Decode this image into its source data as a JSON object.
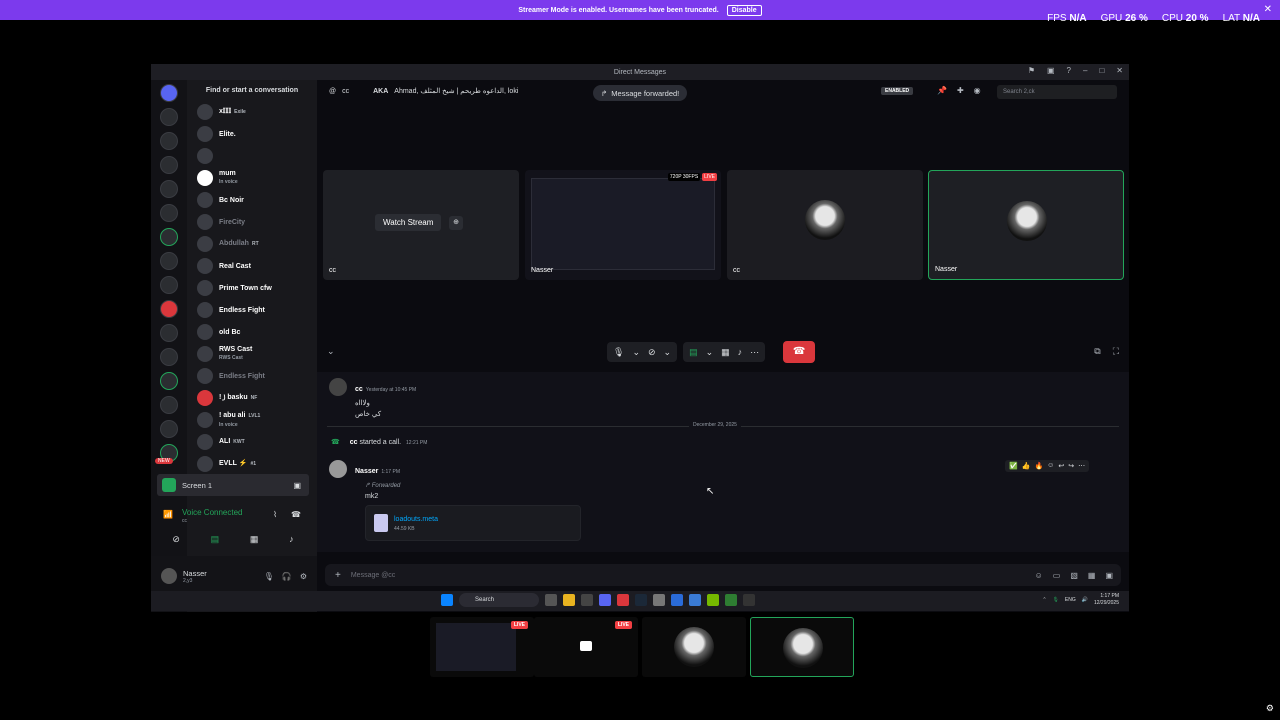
{
  "streamer": {
    "message": "Streamer Mode is enabled. Usernames have been truncated.",
    "button": "Disable"
  },
  "stats": {
    "fps_label": "FPS",
    "fps": "N/A",
    "gpu_label": "GPU",
    "gpu": "26 %",
    "cpu_label": "CPU",
    "cpu": "20 %",
    "lat_label": "LAT",
    "lat": "N/A"
  },
  "window": {
    "title": "Direct Messages"
  },
  "dmlist": {
    "search": "Find or start a conversation",
    "items": [
      {
        "name": "x𝕀𝕀𝕀",
        "tag": "Exile"
      },
      {
        "name": "Elite.",
        "tag": ""
      },
      {
        "name": "",
        "tag": ""
      },
      {
        "name": "mum",
        "tag": "",
        "sub": "In voice"
      },
      {
        "name": "Bc Noir",
        "tag": ""
      },
      {
        "name": "FireCity",
        "tag": ""
      },
      {
        "name": "Abdullah",
        "tag": "RT"
      },
      {
        "name": "Real Cast",
        "tag": ""
      },
      {
        "name": "Prime Town cfw",
        "tag": ""
      },
      {
        "name": "Endless Fight",
        "tag": ""
      },
      {
        "name": "old Bc",
        "tag": ""
      },
      {
        "name": "RWS Cast",
        "tag": "",
        "sub": "RWS Cast"
      },
      {
        "name": "Endless Fight",
        "tag": ""
      },
      {
        "name": "! ꠸ basku",
        "tag": "NF"
      },
      {
        "name": "! abu ali",
        "tag": "LVL1",
        "sub": "In voice"
      },
      {
        "name": "ALI",
        "tag": "KWT"
      },
      {
        "name": "EVLL ⚡",
        "tag": "#1"
      }
    ],
    "new_badge": "NEW"
  },
  "screen_share": {
    "label": "Screen 1"
  },
  "voice": {
    "status": "Voice Connected",
    "sub": "cc"
  },
  "user": {
    "name": "Nasser",
    "sub": "2,y3"
  },
  "topbar": {
    "dm_name": "cc",
    "aka": "AKA",
    "aka_names": "Ahmad, الداعوه طريحم | شيخ المثلف, loki",
    "toast": "Message forwarded!",
    "enabled": "ENABLED",
    "search_placeholder": "Search 2,ck"
  },
  "tiles": [
    {
      "caption": "cc",
      "action": "Watch Stream"
    },
    {
      "caption": "Nasser",
      "quality": "720P 30FPS",
      "live": "LIVE"
    },
    {
      "caption": "cc"
    },
    {
      "caption": "Nasser"
    }
  ],
  "chat": {
    "msg1": {
      "name": "cc",
      "time": "Yesterday at 10:45 PM",
      "line1": "ولاااه",
      "line2": "كي خاص"
    },
    "date_divider": "December 29, 2025",
    "call": {
      "name": "cc",
      "text": "started a call.",
      "time": "12:21 PM"
    },
    "msg2": {
      "name": "Nasser",
      "time": "1:17 PM",
      "forwarded": "Forwarded",
      "text": "mk2"
    },
    "file": {
      "name": "loadouts.meta",
      "size": "44.59 KB"
    },
    "input_placeholder": "Message @cc"
  },
  "taskbar": {
    "search": "Search",
    "lang": "ENG",
    "time": "1:17 PM",
    "date": "12/29/2025"
  },
  "thumbs": [
    {
      "live": "LIVE"
    },
    {
      "live": "LIVE"
    },
    {},
    {}
  ],
  "colors": {
    "accent": "#7c3aed",
    "green": "#23a55a",
    "red": "#da373c",
    "link": "#00a8fc"
  }
}
